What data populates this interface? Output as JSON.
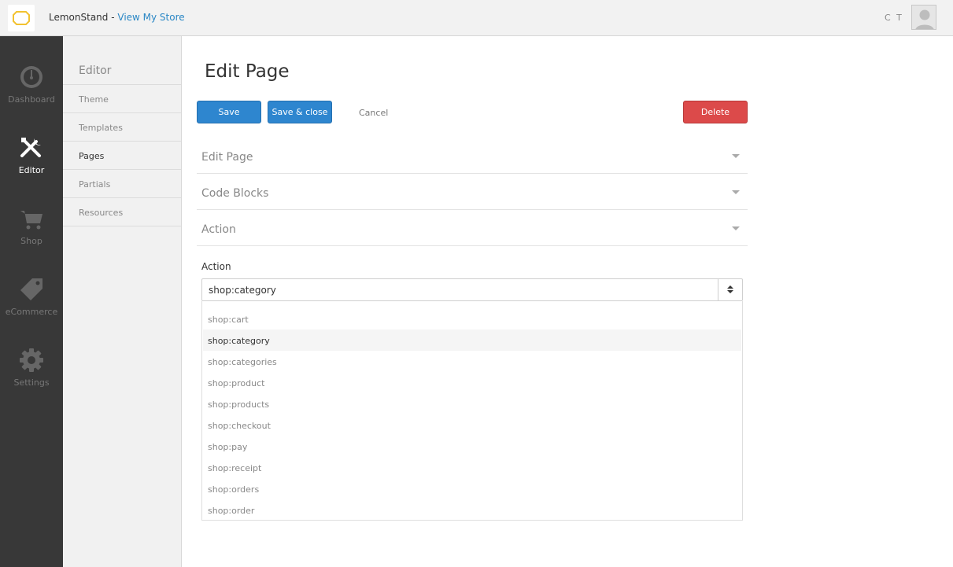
{
  "header": {
    "brand_name": "LemonStand -",
    "view_store_link": "View My Store",
    "user_initials": "C T"
  },
  "nav": {
    "items": [
      {
        "label": "Dashboard",
        "icon": "dashboard-gauge-icon",
        "active": false
      },
      {
        "label": "Editor",
        "icon": "tools-icon",
        "active": true
      },
      {
        "label": "Shop",
        "icon": "cart-icon",
        "active": false
      },
      {
        "label": "eCommerce",
        "icon": "tag-icon",
        "active": false
      },
      {
        "label": "Settings",
        "icon": "gear-icon",
        "active": false
      }
    ]
  },
  "subnav": {
    "title": "Editor",
    "items": [
      "Theme",
      "Templates",
      "Pages",
      "Partials",
      "Resources"
    ],
    "active": "Pages"
  },
  "main": {
    "title": "Edit Page",
    "buttons": {
      "save": "Save",
      "save_close": "Save & close",
      "cancel": "Cancel",
      "delete": "Delete"
    },
    "sections": [
      "Edit Page",
      "Code Blocks",
      "Action"
    ],
    "action_field": {
      "label": "Action",
      "selected": "shop:category",
      "options": [
        "shop:cart",
        "shop:category",
        "shop:categories",
        "shop:product",
        "shop:products",
        "shop:checkout",
        "shop:pay",
        "shop:receipt",
        "shop:orders",
        "shop:order"
      ]
    }
  },
  "colors": {
    "primary": "#2e86cf",
    "danger": "#dc4a4a",
    "logo": "#f2c230",
    "link": "#2a87c5",
    "nav_bg": "#383838"
  }
}
